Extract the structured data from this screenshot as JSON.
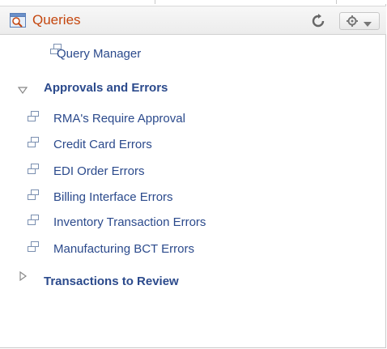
{
  "pagelet": {
    "title": "Queries",
    "accent_color": "#c4460e",
    "link_color": "#2b4a8c",
    "header_icon": "query-icon",
    "refresh_icon": "refresh-icon",
    "options_icon": "gear-icon"
  },
  "top_link": {
    "label": "Query Manager",
    "icon": "link-icon"
  },
  "sections": [
    {
      "title": "Approvals and Errors",
      "expanded": true,
      "items": [
        {
          "label": "RMA's Require Approval",
          "icon": "link-icon"
        },
        {
          "label": "Credit Card Errors",
          "icon": "link-icon"
        },
        {
          "label": "EDI Order Errors",
          "icon": "link-icon"
        },
        {
          "label": "Billing Interface Errors",
          "icon": "link-icon"
        },
        {
          "label": "Inventory Transaction Errors",
          "icon": "link-icon"
        },
        {
          "label": "Manufacturing BCT Errors",
          "icon": "link-icon"
        }
      ]
    },
    {
      "title": "Transactions to Review",
      "expanded": false,
      "items": []
    }
  ]
}
